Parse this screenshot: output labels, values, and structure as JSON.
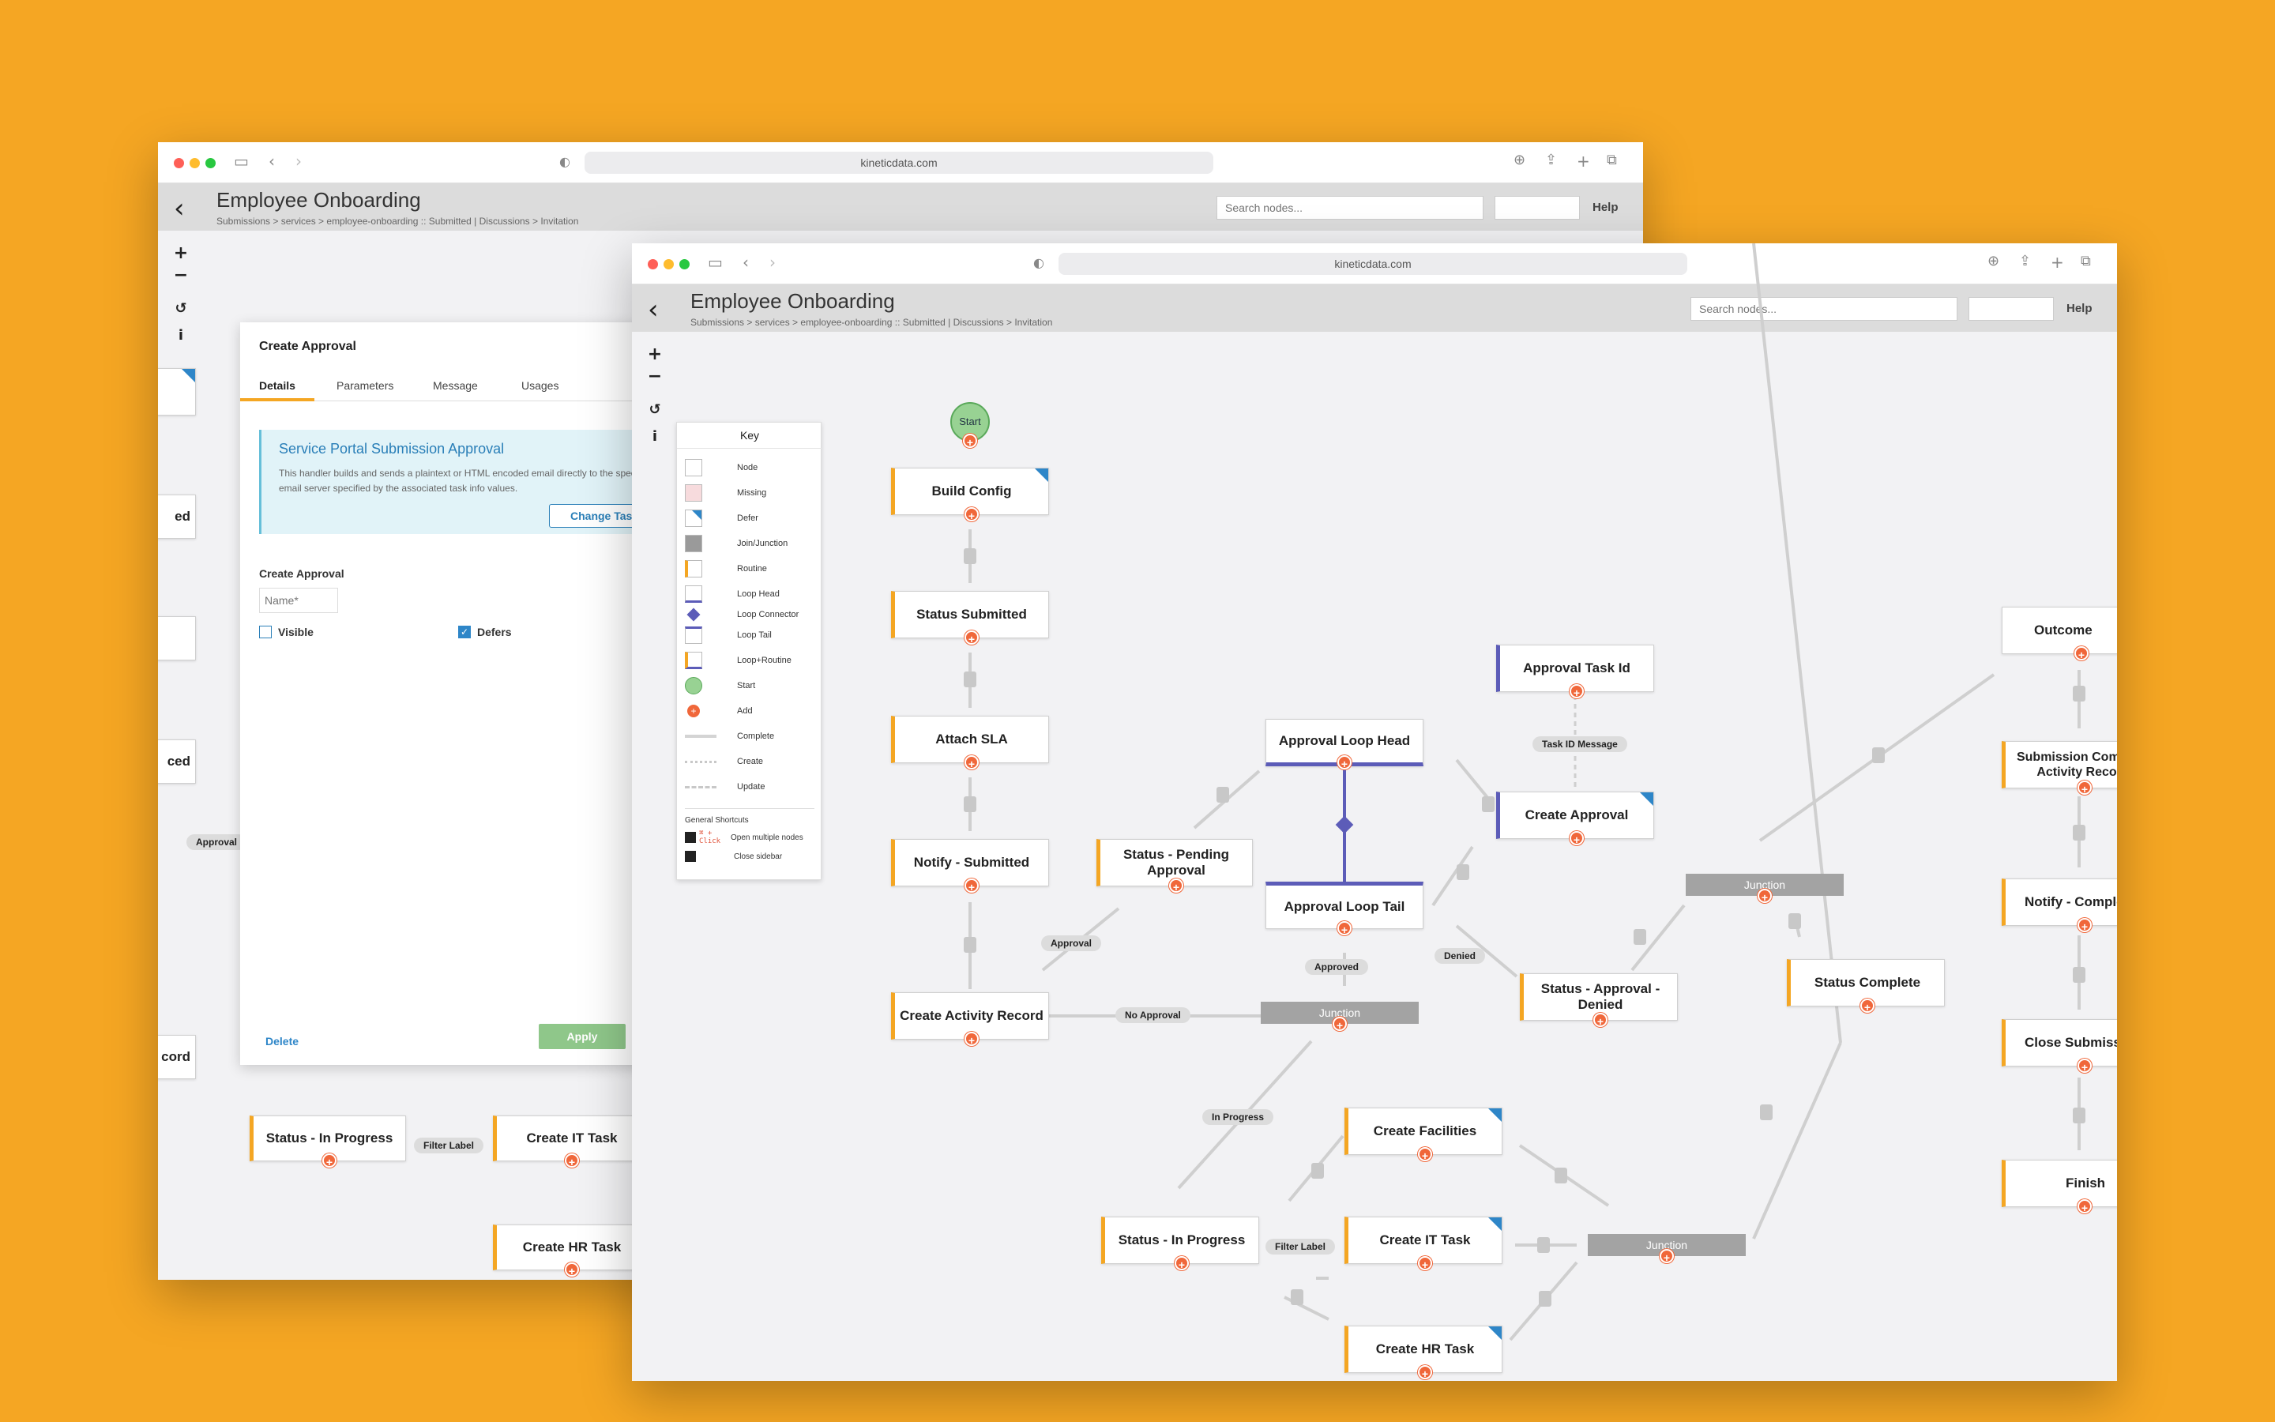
{
  "browser": {
    "url": "kineticdata.com"
  },
  "app": {
    "title": "Employee Onboarding",
    "breadcrumb": "Submissions > services > employee-onboarding :: Submitted",
    "breadcrumb_extra": "Discussions > Invitation",
    "search_placeholder": "Search nodes...",
    "help_label": "Help"
  },
  "toolbar": {
    "zoom_in": "+",
    "zoom_out": "−",
    "reset": "↺",
    "info": "i"
  },
  "key": {
    "title": "Key",
    "items": [
      "Node",
      "Missing",
      "Defer",
      "Join/Junction",
      "Routine",
      "Loop Head",
      "Loop Connector",
      "Loop Tail",
      "Loop+Routine",
      "Start",
      "Add",
      "Complete",
      "Create",
      "Update"
    ],
    "shortcuts_title": "General Shortcuts",
    "shortcut1_key": "⌘ + Click",
    "shortcut1": "Open multiple nodes",
    "shortcut2": "Close sidebar"
  },
  "tree": {
    "start": "Start",
    "nodes": {
      "build_config": "Build Config",
      "status_submitted": "Status Submitted",
      "attach_sla": "Attach SLA",
      "notify_submitted": "Notify - Submitted",
      "create_activity": "Create Activity Record",
      "status_pending": "Status - Pending Approval",
      "loop_head": "Approval Loop Head",
      "loop_tail": "Approval Loop Tail",
      "approval_task_id": "Approval Task Id",
      "create_approval": "Create Approval",
      "status_denied": "Status - Approval - Denied",
      "status_complete": "Status Complete",
      "create_facilities": "Create Facilities",
      "create_it": "Create IT Task",
      "create_hr": "Create HR Task",
      "status_in_progress": "Status - In Progress",
      "outcome": "Outcome",
      "submission_complete": "Submission Complete Activity Record",
      "notify_complete": "Notify - Complete",
      "close_submission": "Close Submission",
      "finish": "Finish"
    },
    "junctions": {
      "j1": "Junction",
      "j2": "Junction",
      "j3": "Junction"
    },
    "labels": {
      "approval": "Approval",
      "no_approval": "No Approval",
      "approved": "Approved",
      "denied": "Denied",
      "task_id_message": "Task ID Message",
      "in_progress": "In Progress",
      "filter_label": "Filter Label"
    }
  },
  "back_window": {
    "panel_title": "Create Approval",
    "tabs": [
      "Details",
      "Parameters",
      "Message",
      "Usages"
    ],
    "active_tab": "Details",
    "handler_title": "Service Portal Submission Approval",
    "handler_desc": "This handler builds and sends a plaintext or HTML encoded email directly to the specified email server specified by the associated task info values.",
    "change_task": "Change Task",
    "section_label": "Create Approval",
    "name_placeholder": "Name*",
    "visible_label": "Visible",
    "visible_checked": false,
    "defers_label": "Defers",
    "defers_checked": true,
    "delete_label": "Delete",
    "apply_label": "Apply",
    "bg_labels": {
      "status_in_progress": "Status - In Progress",
      "create_it": "Create IT Task",
      "create_hr": "Create HR Task",
      "filter_label": "Filter Label",
      "approval": "Approval",
      "partial1": "ed",
      "partial2": "ced",
      "partial3": "cord"
    }
  },
  "colors": {
    "background": "#f5a623",
    "routine": "#f4a623",
    "loop": "#5c5cb8",
    "defer": "#2e86c8",
    "add": "#f0673a",
    "junction": "#a3a3a3",
    "start": "#98d293"
  }
}
